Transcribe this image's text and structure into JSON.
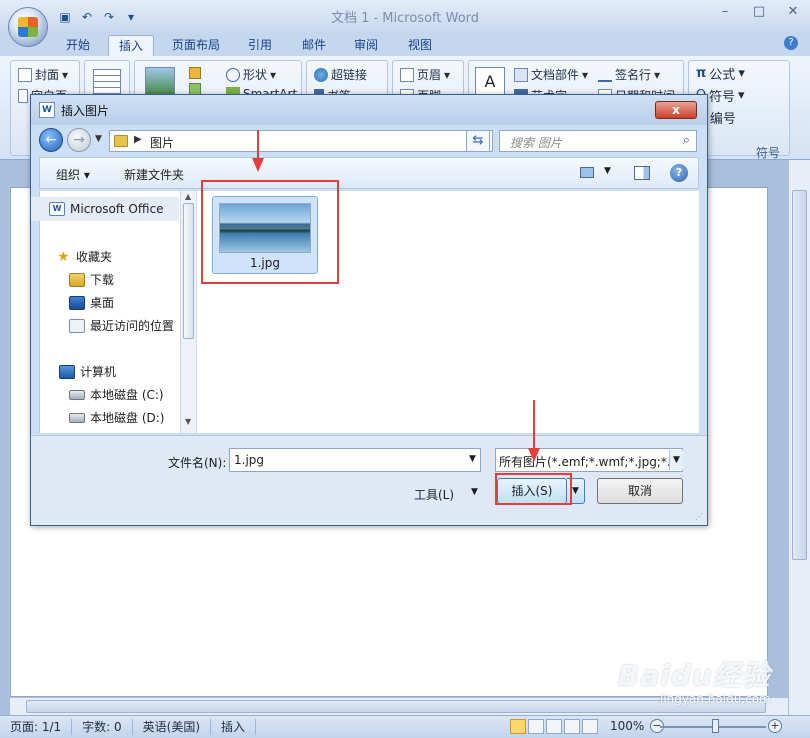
{
  "window": {
    "title": "文档 1 - Microsoft Word",
    "quick_access": [
      "save-icon",
      "undo-icon",
      "redo-icon"
    ],
    "controls": [
      "minimize-icon",
      "maximize-icon",
      "close-icon"
    ]
  },
  "ribbon": {
    "tabs": [
      "开始",
      "插入",
      "页面布局",
      "引用",
      "邮件",
      "审阅",
      "视图"
    ],
    "active_tab": "插入",
    "items": {
      "cover": "封面",
      "cover_sub": "空白页",
      "shapes": "形状",
      "hyperlink": "超链接",
      "smartart": "SmartArt",
      "bookmark": "书签",
      "header": "页眉",
      "footer": "页脚",
      "docparts": "文档部件",
      "wordart": "艺术字",
      "signature": "签名行",
      "datetime": "日期和时间",
      "equation": "公式",
      "symbol": "符号",
      "number": "编号",
      "group_symbol": "符号"
    }
  },
  "dialog": {
    "title": "插入图片",
    "close_label": "x",
    "address": {
      "path": "图片"
    },
    "search_placeholder": "搜索 图片",
    "toolbar": {
      "organize": "组织 ▾",
      "new_folder": "新建文件夹"
    },
    "nav": [
      {
        "label": "Microsoft Office",
        "icon": "word-doc-icon"
      },
      {
        "label": "收藏夹",
        "icon": "star-icon"
      },
      {
        "label": "下载",
        "icon": "download-folder-icon"
      },
      {
        "label": "桌面",
        "icon": "desktop-icon"
      },
      {
        "label": "最近访问的位置",
        "icon": "recent-places-icon"
      },
      {
        "label": "计算机",
        "icon": "computer-icon"
      },
      {
        "label": "本地磁盘 (C:)",
        "icon": "drive-c-icon"
      },
      {
        "label": "本地磁盘 (D:)",
        "icon": "drive-d-icon"
      }
    ],
    "files": [
      {
        "name": "1.jpg",
        "icon": "image-thumbnail"
      }
    ],
    "filename_label": "文件名(N):",
    "filename_value": "1.jpg",
    "filter_value": "所有图片(*.emf;*.wmf;*.jpg;*.jp",
    "tools_label": "工具(L)",
    "insert_label": "插入(S)",
    "cancel_label": "取消"
  },
  "statusbar": {
    "page": "页面: 1/1",
    "words": "字数: 0",
    "language": "英语(美国)",
    "mode": "插入",
    "zoom": "100%"
  },
  "watermark": {
    "brand": "Baidu经验",
    "url": "jingyan.baidu.com"
  },
  "colors": {
    "highlight": "#e33d3d",
    "ribbon_bg": "#d4e2f3",
    "dialog_bg": "#cddff4"
  }
}
